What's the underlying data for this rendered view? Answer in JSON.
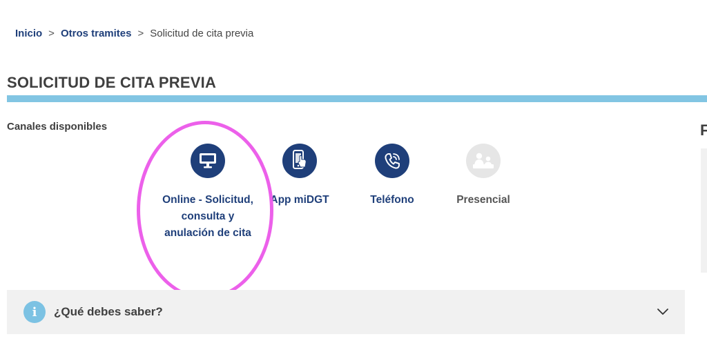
{
  "breadcrumb": {
    "home": "Inicio",
    "parent": "Otros tramites",
    "current": "Solicitud de cita previa",
    "separator": ">"
  },
  "page": {
    "title": "SOLICITUD DE CITA PREVIA",
    "channels_label": "Canales disponibles",
    "right_edge_text": "F"
  },
  "channels": [
    {
      "icon": "monitor-icon",
      "label": "Online - Solicitud, consulta y anulación de cita",
      "enabled": true
    },
    {
      "icon": "mobile-app-icon",
      "label": "App miDGT",
      "enabled": true
    },
    {
      "icon": "phone-icon",
      "label": "Teléfono",
      "enabled": true
    },
    {
      "icon": "in-person-icon",
      "label": "Presencial",
      "enabled": false
    }
  ],
  "accordion": {
    "icon_text": "i",
    "title": "¿Qué debes saber?",
    "icon": "chevron-down-icon"
  },
  "colors": {
    "primary": "#1f3f7a",
    "accent_bar": "#82c5e3",
    "info_icon": "#7cc2e3",
    "highlight": "#ec60ea",
    "disabled_icon_bg": "#e6e6e6",
    "panel_bg": "#f1f1f1"
  }
}
